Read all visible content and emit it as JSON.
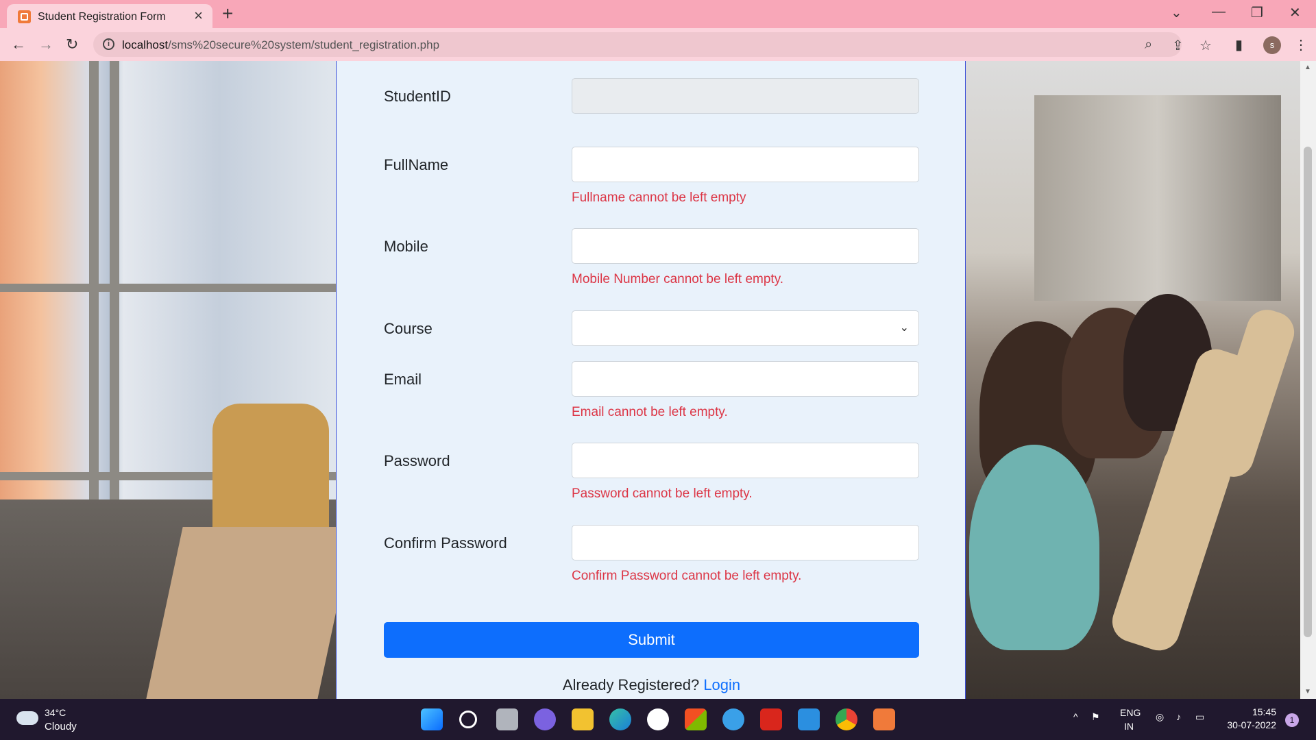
{
  "browser": {
    "tab_title": "Student Registration Form",
    "url_host": "localhost",
    "url_path": "/sms%20secure%20system/student_registration.php",
    "profile_initial": "s"
  },
  "form": {
    "fields": [
      {
        "label": "StudentID",
        "value": "",
        "error": ""
      },
      {
        "label": "FullName",
        "value": "",
        "error": "Fullname cannot be left empty"
      },
      {
        "label": "Mobile",
        "value": "",
        "error": "Mobile Number cannot be left empty."
      },
      {
        "label": "Course",
        "value": "",
        "error": ""
      },
      {
        "label": "Email",
        "value": "",
        "error": "Email cannot be left empty."
      },
      {
        "label": "Password",
        "value": "",
        "error": "Password cannot be left empty."
      },
      {
        "label": "Confirm Password",
        "value": "",
        "error": "Confirm Password cannot be left empty."
      }
    ],
    "submit_label": "Submit",
    "already_text": "Already Registered?",
    "login_label": "Login"
  },
  "taskbar": {
    "temperature": "34°C",
    "condition": "Cloudy",
    "lang_top": "ENG",
    "lang_bottom": "IN",
    "time": "15:45",
    "date": "30-07-2022",
    "notification_count": "1"
  },
  "colors": {
    "tab_strip": "#f8a7b8",
    "panel_bg": "#e9f2fb",
    "primary": "#0d6efd",
    "error": "#dc3545"
  }
}
